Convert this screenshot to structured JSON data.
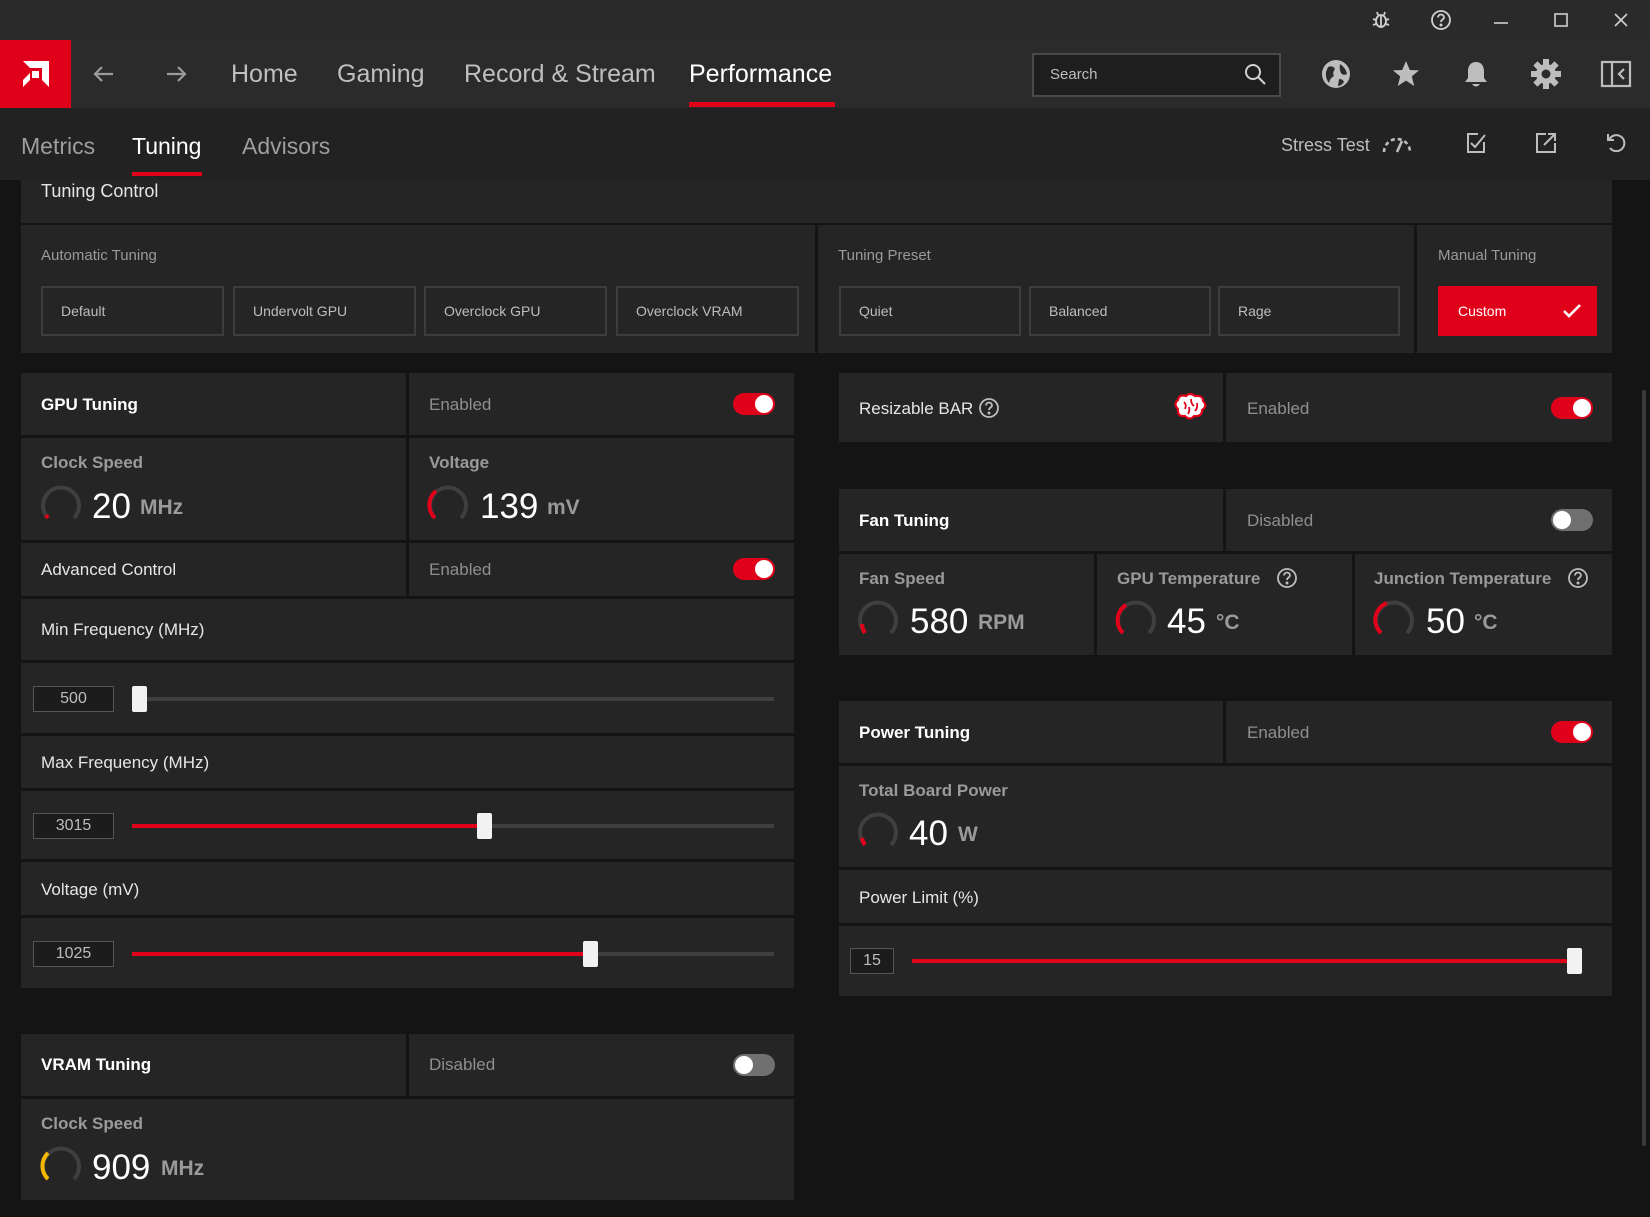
{
  "nav": {
    "tabs": [
      "Home",
      "Gaming",
      "Record & Stream",
      "Performance"
    ],
    "active_tab": "Performance",
    "search_placeholder": "Search"
  },
  "subnav": {
    "tabs": [
      "Metrics",
      "Tuning",
      "Advisors"
    ],
    "active_tab": "Tuning",
    "stress_test_label": "Stress Test"
  },
  "icons": {
    "titlebar": [
      "bug-icon",
      "help-icon",
      "minimize-icon",
      "maximize-icon",
      "close-icon"
    ],
    "nav": [
      "globe-icon",
      "star-icon",
      "bell-icon",
      "gear-icon",
      "sidebar-toggle-icon"
    ],
    "subnav": [
      "gauge-icon",
      "apply-icon",
      "export-icon",
      "reset-icon"
    ]
  },
  "colors": {
    "accent": "#e1001a",
    "vram_gauge": "#f5b800"
  },
  "tuning_control": {
    "title": "Tuning Control",
    "automatic": {
      "label": "Automatic Tuning",
      "options": [
        "Default",
        "Undervolt GPU",
        "Overclock GPU",
        "Overclock VRAM"
      ]
    },
    "preset": {
      "label": "Tuning Preset",
      "options": [
        "Quiet",
        "Balanced",
        "Rage"
      ]
    },
    "manual": {
      "label": "Manual Tuning",
      "selected": "Custom"
    }
  },
  "gpu_tuning": {
    "title": "GPU Tuning",
    "status": "Enabled",
    "enabled": true,
    "clock_speed": {
      "label": "Clock Speed",
      "value": "20",
      "unit": "MHz"
    },
    "voltage": {
      "label": "Voltage",
      "value": "139",
      "unit": "mV"
    },
    "advanced_control": {
      "label": "Advanced Control",
      "status": "Enabled",
      "enabled": true
    },
    "min_frequency": {
      "label": "Min Frequency (MHz)",
      "value": "500",
      "fraction": 0.0
    },
    "max_frequency": {
      "label": "Max Frequency (MHz)",
      "value": "3015",
      "fraction": 0.55
    },
    "voltage_slider": {
      "label": "Voltage (mV)",
      "value": "1025",
      "fraction": 0.72
    }
  },
  "vram_tuning": {
    "title": "VRAM Tuning",
    "status": "Disabled",
    "enabled": false,
    "clock_speed": {
      "label": "Clock Speed",
      "value": "909",
      "unit": "MHz"
    }
  },
  "resizable_bar": {
    "label": "Resizable BAR",
    "status": "Enabled",
    "enabled": true
  },
  "fan_tuning": {
    "title": "Fan Tuning",
    "status": "Disabled",
    "enabled": false,
    "fan_speed": {
      "label": "Fan Speed",
      "value": "580",
      "unit": "RPM"
    },
    "gpu_temperature": {
      "label": "GPU Temperature",
      "value": "45",
      "unit": "°C"
    },
    "junction_temperature": {
      "label": "Junction Temperature",
      "value": "50",
      "unit": "°C"
    }
  },
  "power_tuning": {
    "title": "Power Tuning",
    "status": "Enabled",
    "enabled": true,
    "total_board_power": {
      "label": "Total Board Power",
      "value": "40",
      "unit": "W"
    },
    "power_limit": {
      "label": "Power Limit (%)",
      "value": "15",
      "fraction": 1.0
    }
  }
}
